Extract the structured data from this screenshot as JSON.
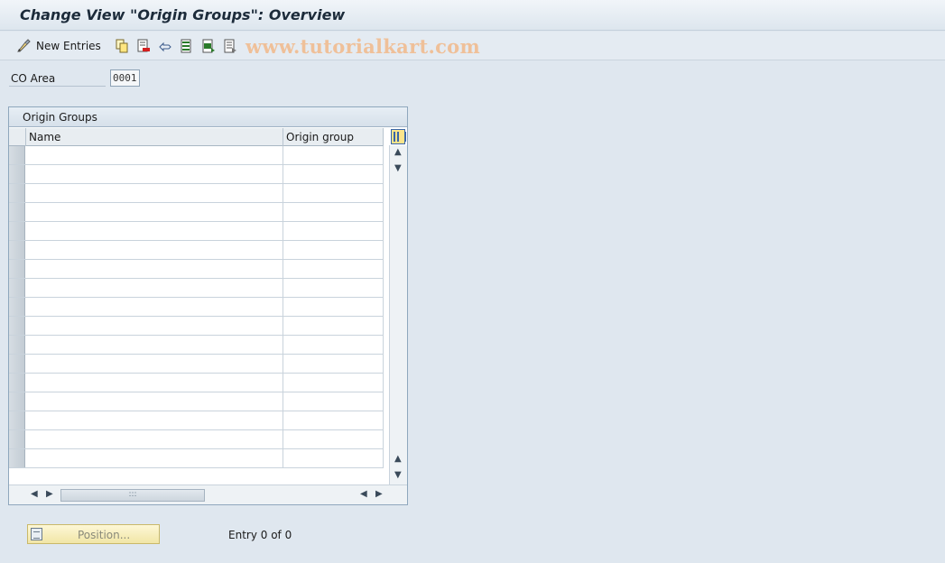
{
  "window": {
    "title": "Change View \"Origin Groups\": Overview"
  },
  "toolbar": {
    "new_entries_label": "New Entries",
    "icons": [
      "edit-glasses-icon",
      "copy-icon",
      "delete-icon",
      "undo-icon",
      "select-all-icon",
      "select-block-icon",
      "deselect-all-icon"
    ]
  },
  "watermark": "www.tutorialkart.com",
  "header": {
    "co_area_label": "CO Area",
    "co_area_value": "0001"
  },
  "table": {
    "title": "Origin Groups",
    "columns": [
      "Name",
      "Origin group"
    ],
    "row_count": 17
  },
  "footer": {
    "position_label": "Position...",
    "entry_text": "Entry 0 of 0"
  }
}
